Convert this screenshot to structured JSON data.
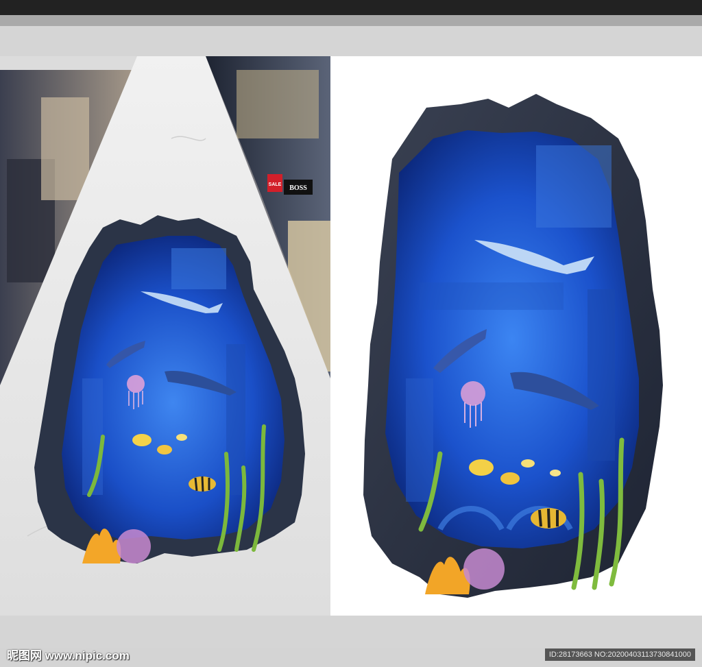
{
  "watermark": {
    "site_text": "昵图网 www.nipic.com"
  },
  "image_id": {
    "text": "ID:28173663 NO:20200403113730841000"
  },
  "left_panel": {
    "store_signs": [
      "SALE",
      "BOSS"
    ]
  },
  "colors": {
    "ocean_deep": "#0c2a8c",
    "ocean_mid": "#1f5fd6",
    "rock": "#2a3346",
    "marble": "#e8e8e8",
    "background": "#d5d5d5"
  }
}
